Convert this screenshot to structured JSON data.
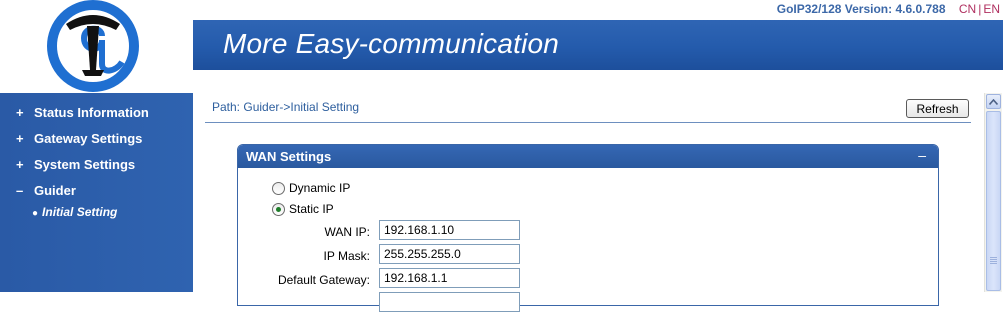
{
  "header": {
    "version_text": "GoIP32/128 Version: 4.6.0.788",
    "lang_cn": "CN",
    "lang_sep": "|",
    "lang_en": "EN",
    "banner_title": "More Easy-communication"
  },
  "sidebar": {
    "items": [
      {
        "sign": "+",
        "label": "Status Information"
      },
      {
        "sign": "+",
        "label": "Gateway Settings"
      },
      {
        "sign": "+",
        "label": "System Settings"
      },
      {
        "sign": "–",
        "label": "Guider"
      }
    ],
    "sub_item": {
      "bullet": "●",
      "label": "Initial Setting"
    }
  },
  "main": {
    "path": "Path: Guider->Initial Setting",
    "refresh_label": "Refresh",
    "panel": {
      "title": "WAN Settings",
      "collapse_symbol": "–",
      "radio_dynamic": "Dynamic IP",
      "radio_static": "Static IP",
      "selected": "static",
      "fields": {
        "wan_ip": {
          "label": "WAN IP:",
          "value": "192.168.1.10"
        },
        "ip_mask": {
          "label": "IP Mask:",
          "value": "255.255.255.0"
        },
        "gateway": {
          "label": "Default Gateway:",
          "value": "192.168.1.1"
        }
      }
    }
  },
  "colors": {
    "accent_blue": "#2a5aa6",
    "lang_color": "#b03060",
    "version_color": "#3c68a8"
  }
}
